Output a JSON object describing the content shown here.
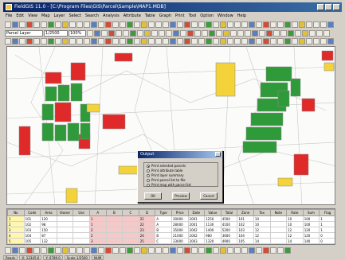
{
  "window": {
    "title": "FieldGIS 11.0 - [C:\\Program Files\\GIS\\Parcel\\Sample\\MAP1.MDB]"
  },
  "menu": [
    "File",
    "Edit",
    "View",
    "Map",
    "Layer",
    "Select",
    "Search",
    "Analysis",
    "Attribute",
    "Table",
    "Graph",
    "Print",
    "Tool",
    "Option",
    "Window",
    "Help"
  ],
  "toolbar": {
    "layer_value": "Parcel Layer",
    "scale_value": "1/2500",
    "zoom_value": "100%"
  },
  "dialog": {
    "title": "Output",
    "options": [
      {
        "label": "Print selected parcels",
        "checked": true
      },
      {
        "label": "Print attribute table",
        "checked": false
      },
      {
        "label": "Print layer summary",
        "checked": false
      },
      {
        "label": "Print parcel list to file",
        "checked": false
      },
      {
        "label": "Print map with parcel list",
        "checked": false
      }
    ],
    "buttons": {
      "ok": "OK",
      "preview": "Preview",
      "cancel": "Cancel"
    }
  },
  "table": {
    "headers": [
      "No",
      "Code",
      "Area",
      "Owner",
      "Use",
      "A",
      "B",
      "C",
      "D",
      "Type",
      "Price",
      "Date",
      "Value",
      "Total",
      "Zone",
      "Tax",
      "Note",
      "Rate",
      "Sum",
      "Flag"
    ],
    "rows": [
      [
        "1",
        "101",
        "120",
        "",
        "",
        "1",
        "",
        "",
        "21",
        "A",
        "30000",
        "2001",
        "1250",
        "4500",
        "101",
        "10",
        "",
        "10",
        "100",
        "1"
      ],
      [
        "2",
        "102",
        "98",
        "",
        "",
        "1",
        "",
        "",
        "22",
        "A",
        "28000",
        "2001",
        "1130",
        "4100",
        "102",
        "10",
        "",
        "10",
        "100",
        "1"
      ],
      [
        "3",
        "103",
        "150",
        "",
        "",
        "2",
        "",
        "",
        "23",
        "B",
        "35000",
        "2002",
        "1400",
        "5200",
        "103",
        "12",
        "",
        "12",
        "120",
        "1"
      ],
      [
        "4",
        "104",
        "87",
        "",
        "",
        "2",
        "",
        "",
        "24",
        "B",
        "21000",
        "2002",
        "980",
        "3600",
        "104",
        "12",
        "",
        "12",
        "120",
        "0"
      ],
      [
        "5",
        "105",
        "132",
        "",
        "",
        "3",
        "",
        "",
        "25",
        "C",
        "33000",
        "2003",
        "1320",
        "4900",
        "105",
        "14",
        "",
        "14",
        "140",
        "0"
      ]
    ]
  },
  "status": [
    "Ready",
    "X: 12345.6",
    "Y: 6789.0",
    "Scale 1/2500",
    "NUM"
  ],
  "colors": {
    "red": "#e02a2a",
    "green": "#2f9a3a",
    "yellow": "#f3d23a"
  }
}
